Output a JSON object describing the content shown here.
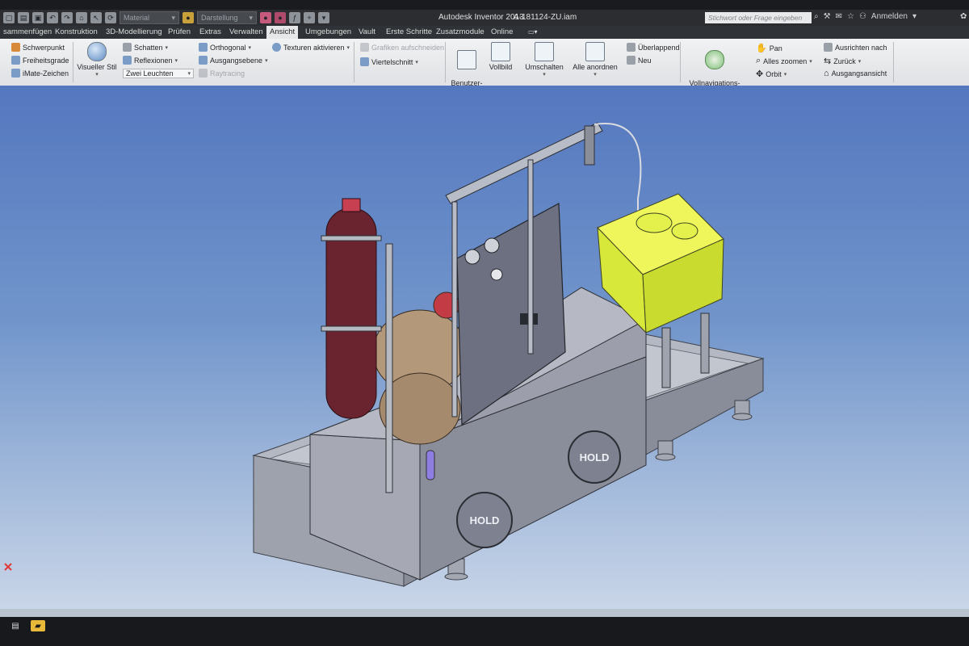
{
  "window": {
    "app_title": "Autodesk Inventor 2013",
    "file_name": "A-181124-ZU.iam",
    "material_combo": "Material",
    "appearance_combo": "Darstellung",
    "search_placeholder": "Stichwort oder Frage eingeben",
    "sign_in": "Anmelden"
  },
  "tabs": [
    {
      "label": "sammenfügen"
    },
    {
      "label": "Konstruktion"
    },
    {
      "label": "3D-Modellierung"
    },
    {
      "label": "Prüfen"
    },
    {
      "label": "Extras"
    },
    {
      "label": "Verwalten"
    },
    {
      "label": "Ansicht",
      "active": true
    },
    {
      "label": "Umgebungen"
    },
    {
      "label": "Vault"
    },
    {
      "label": "Erste Schritte"
    },
    {
      "label": "Zusatzmodule"
    },
    {
      "label": "Online"
    }
  ],
  "ribbon": {
    "visibility": {
      "schwerpunkt": "Schwerpunkt",
      "freiheitsgrade": "Freiheitsgrade",
      "imate": "iMate-Zeichen"
    },
    "appearance": {
      "visual_style": "Visueller Stil",
      "shadows": "Schatten",
      "reflections": "Reflexionen",
      "lighting": "Zwei Leuchten",
      "orthographic": "Orthogonal",
      "ground_plane": "Ausgangsebene",
      "raytracing": "Raytracing",
      "textures": "Texturen aktivieren"
    },
    "graphics": {
      "section_graphics": "Grafiken aufschneiden",
      "quarter_section": "Viertelschnitt"
    },
    "windows": {
      "user_interface": "Benutzer-\noberfläche",
      "full_screen": "Vollbild",
      "switch": "Umschalten",
      "arrange_all": "Alle anordnen",
      "cascade": "Überlappend",
      "new": "Neu"
    },
    "navigate": {
      "steering_wheel": "Vollnavigations-\nRad",
      "pan": "Pan",
      "zoom_all": "Alles zoomen",
      "orbit": "Orbit",
      "look_at": "Ausrichten nach",
      "previous": "Zurück",
      "home": "Ausgangsansicht"
    }
  },
  "model": {
    "brand_label": "HOLD"
  },
  "colors": {
    "viewport_top": "#5477bf",
    "viewport_bottom": "#c9d5e8",
    "highlight": "#ddf03a",
    "accumulator": "#6a2430"
  }
}
